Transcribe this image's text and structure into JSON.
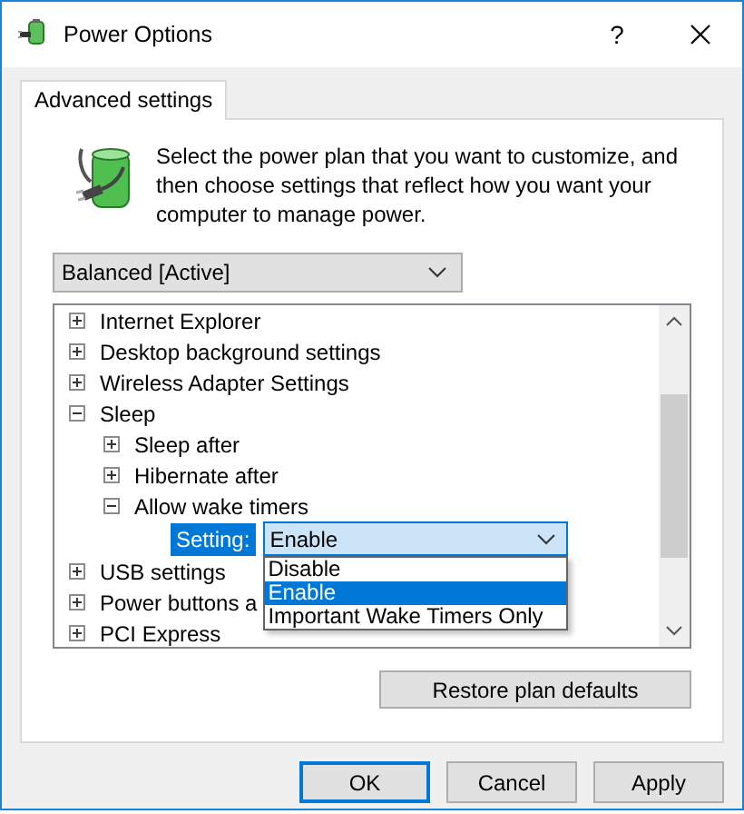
{
  "window": {
    "title": "Power Options",
    "help": "?"
  },
  "tabs": [
    {
      "label": "Advanced settings",
      "selected": true
    }
  ],
  "description": "Select the power plan that you want to customize, and then choose settings that reflect how you want your computer to manage power.",
  "plan_dropdown": {
    "value": "Balanced [Active]"
  },
  "tree": [
    {
      "kind": "group",
      "label": "Internet Explorer",
      "expanded": false
    },
    {
      "kind": "group",
      "label": "Desktop background settings",
      "expanded": false
    },
    {
      "kind": "group",
      "label": "Wireless Adapter Settings",
      "expanded": false
    },
    {
      "kind": "group",
      "label": "Sleep",
      "expanded": true,
      "children": [
        {
          "kind": "group",
          "label": "Sleep after",
          "expanded": false
        },
        {
          "kind": "group",
          "label": "Hibernate after",
          "expanded": false
        },
        {
          "kind": "group",
          "label": "Allow wake timers",
          "expanded": true,
          "children": [
            {
              "kind": "setting",
              "label": "Setting:",
              "value": "Enable",
              "options": [
                {
                  "label": "Disable",
                  "selected": false
                },
                {
                  "label": "Enable",
                  "selected": true
                },
                {
                  "label": "Important Wake Timers Only",
                  "selected": false
                }
              ]
            }
          ]
        }
      ]
    },
    {
      "kind": "group",
      "label": "USB settings",
      "expanded": false
    },
    {
      "kind": "group",
      "label": "Power buttons a",
      "expanded": false
    },
    {
      "kind": "group",
      "label": "PCI Express",
      "expanded": false
    }
  ],
  "restore_button": "Restore plan defaults",
  "buttons": [
    {
      "label": "OK",
      "default": true
    },
    {
      "label": "Cancel",
      "default": false
    },
    {
      "label": "Apply",
      "default": false
    }
  ]
}
